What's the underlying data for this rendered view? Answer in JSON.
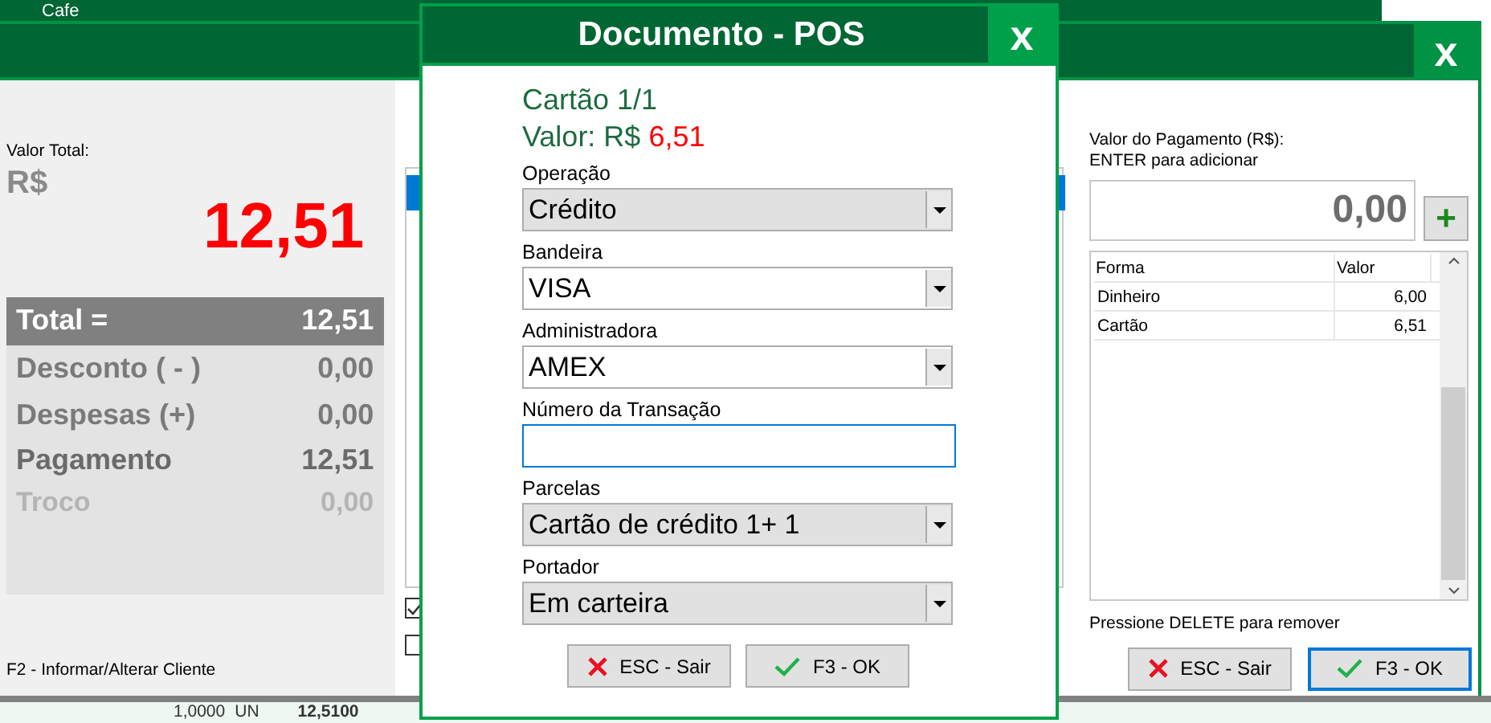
{
  "app": {
    "title": "Cafe"
  },
  "payment_window": {
    "valor_total_label": "Valor Total:",
    "currency": "R$",
    "valor_total": "12,51",
    "summary": [
      {
        "label": "Total =",
        "value": "12,51",
        "kind": "header"
      },
      {
        "label": "Desconto ( - )",
        "value": "0,00",
        "kind": "normal"
      },
      {
        "label": "Despesas (+)",
        "value": "0,00",
        "kind": "normal"
      },
      {
        "label": "Pagamento",
        "value": "12,51",
        "kind": "strong"
      },
      {
        "label": "Troco",
        "value": "0,00",
        "kind": "faded"
      }
    ],
    "client_hint": "F2 - Informar/Alterar Cliente",
    "close": "x",
    "options": [
      {
        "checked": true
      },
      {
        "checked": false
      }
    ],
    "amount_label": "Valor do Pagamento (R$):",
    "amount_hint": "ENTER para adicionar",
    "amount": "0,00",
    "add": "+",
    "table": {
      "columns": [
        "Forma",
        "Valor"
      ],
      "rows": [
        [
          "Dinheiro",
          "6,00"
        ],
        [
          "Cartão",
          "6,51"
        ]
      ]
    },
    "remove_hint": "Pressione DELETE para remover",
    "buttons": [
      {
        "label": "ESC - Sair",
        "kind": "cancel",
        "focused": false
      },
      {
        "label": "F3 - OK",
        "kind": "ok",
        "focused": true
      }
    ]
  },
  "item_row": [
    "1,0000",
    "UN",
    "12,5100"
  ],
  "dialog": {
    "title": "Documento - POS",
    "close": "x",
    "card": "Cartão 1/1",
    "valor_label": "Valor: R$",
    "valor": "6,51",
    "fields": [
      {
        "label": "Operação",
        "value": "Crédito",
        "kind": "list"
      },
      {
        "label": "Bandeira",
        "value": "VISA",
        "kind": "combo"
      },
      {
        "label": "Administradora",
        "value": "AMEX",
        "kind": "combo"
      },
      {
        "label": "Número da Transação",
        "kind": "text"
      },
      {
        "label": "Parcelas",
        "value": "Cartão de crédito 1+ 1",
        "kind": "list"
      },
      {
        "label": "Portador",
        "value": "Em carteira",
        "kind": "list"
      }
    ],
    "buttons": [
      {
        "label": "ESC - Sair",
        "kind": "cancel",
        "focused": false
      },
      {
        "label": "F3 - OK",
        "kind": "ok",
        "focused": false
      }
    ]
  }
}
